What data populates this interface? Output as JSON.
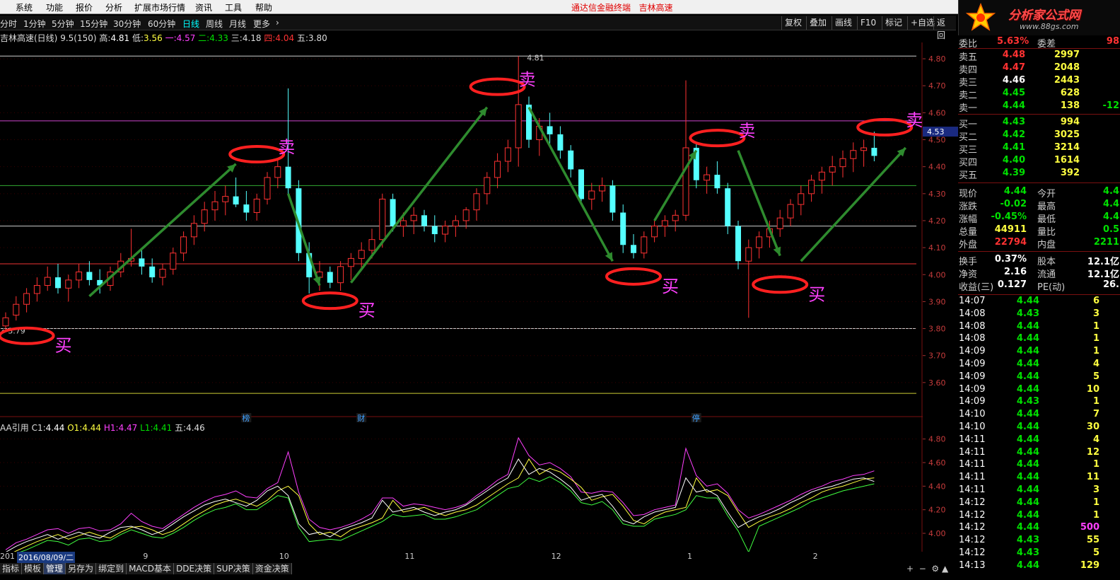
{
  "menu": {
    "items": [
      "系统",
      "功能",
      "报价",
      "分析",
      "扩展市场行情",
      "资讯",
      "工具",
      "帮助"
    ],
    "center_title": "通达信金融终端",
    "stock_name": "吉林高速"
  },
  "logo": {
    "text": "分析家公式网",
    "url": "www.88gs.com"
  },
  "periods": [
    "分时",
    "1分钟",
    "5分钟",
    "15分钟",
    "30分钟",
    "60分钟",
    "日线",
    "周线",
    "月线",
    "更多",
    "›"
  ],
  "active_period": "日线",
  "tools": [
    "复权",
    "叠加",
    "画线",
    "F10",
    "标记",
    "+自选",
    "返回"
  ],
  "info": {
    "name": "吉林高速(日线)",
    "pe": "9.5(150)",
    "high_label": "高:",
    "high": "4.81",
    "low_label": "低:",
    "low": "3.56",
    "l1_label": "一:",
    "l1": "4.57",
    "l2_label": "二:",
    "l2": "4.33",
    "l3_label": "三:",
    "l3": "4.18",
    "l4_label": "四:",
    "l4": "4.04",
    "l5_label": "五:",
    "l5": "3.80"
  },
  "indicator": {
    "name": "AA引用",
    "c1_label": "C1:",
    "c1": "4.44",
    "o1_label": "O1:",
    "o1": "4.44",
    "h1_label": "H1:",
    "h1": "4.47",
    "l1_label": "L1:",
    "l1": "4.41",
    "w_label": "五:",
    "w": "4.46"
  },
  "chart_data": {
    "type": "candlestick",
    "main_ylim": [
      3.5,
      4.85
    ],
    "main_ticks": [
      3.6,
      3.7,
      3.8,
      3.9,
      4.0,
      4.1,
      4.2,
      4.3,
      4.4,
      4.5,
      4.6,
      4.7,
      4.8
    ],
    "ind_ylim": [
      3.85,
      4.9
    ],
    "ind_ticks": [
      4.0,
      4.2,
      4.4,
      4.6,
      4.8
    ],
    "hlines": [
      4.81,
      4.57,
      4.33,
      4.18,
      4.04,
      3.8,
      3.56
    ],
    "hline_colors": [
      "#cccccc",
      "#cc44cc",
      "#33aa33",
      "#cccccc",
      "#ee3333",
      "#cccccc",
      "#cccc33"
    ],
    "current_price": "4.53",
    "max_label": "4.81",
    "min_label": "3.79",
    "candles": [
      [
        3.81,
        3.86,
        3.79,
        3.84
      ],
      [
        3.85,
        3.92,
        3.83,
        3.89
      ],
      [
        3.89,
        3.95,
        3.86,
        3.93
      ],
      [
        3.93,
        3.99,
        3.9,
        3.96
      ],
      [
        3.96,
        4.03,
        3.94,
        3.99
      ],
      [
        3.99,
        4.04,
        3.93,
        3.95
      ],
      [
        3.95,
        4.0,
        3.9,
        3.98
      ],
      [
        3.98,
        4.04,
        3.95,
        4.01
      ],
      [
        4.01,
        4.05,
        3.96,
        3.98
      ],
      [
        3.98,
        4.02,
        3.93,
        3.96
      ],
      [
        3.96,
        4.03,
        3.94,
        4.01
      ],
      [
        4.01,
        4.08,
        3.99,
        4.05
      ],
      [
        4.05,
        4.17,
        4.03,
        4.06
      ],
      [
        4.06,
        4.1,
        4.0,
        4.03
      ],
      [
        4.03,
        4.06,
        3.97,
        3.99
      ],
      [
        3.99,
        4.04,
        3.96,
        4.02
      ],
      [
        4.02,
        4.1,
        4.0,
        4.08
      ],
      [
        4.08,
        4.16,
        4.05,
        4.14
      ],
      [
        4.14,
        4.22,
        4.11,
        4.19
      ],
      [
        4.19,
        4.27,
        4.16,
        4.24
      ],
      [
        4.24,
        4.31,
        4.2,
        4.27
      ],
      [
        4.27,
        4.33,
        4.22,
        4.29
      ],
      [
        4.29,
        4.36,
        4.25,
        4.26
      ],
      [
        4.26,
        4.31,
        4.2,
        4.23
      ],
      [
        4.23,
        4.3,
        4.2,
        4.28
      ],
      [
        4.28,
        4.38,
        4.26,
        4.36
      ],
      [
        4.36,
        4.43,
        4.32,
        4.4
      ],
      [
        4.4,
        4.69,
        4.3,
        4.32
      ],
      [
        4.32,
        4.35,
        4.05,
        4.08
      ],
      [
        4.08,
        4.12,
        3.93,
        3.99
      ],
      [
        3.99,
        4.05,
        3.94,
        4.01
      ],
      [
        4.01,
        4.03,
        3.95,
        3.97
      ],
      [
        3.97,
        4.05,
        3.94,
        4.03
      ],
      [
        4.03,
        4.08,
        3.98,
        4.06
      ],
      [
        4.06,
        4.12,
        4.02,
        4.09
      ],
      [
        4.09,
        4.17,
        4.06,
        4.13
      ],
      [
        4.13,
        4.3,
        4.1,
        4.28
      ],
      [
        4.28,
        4.3,
        4.16,
        4.18
      ],
      [
        4.18,
        4.23,
        4.14,
        4.2
      ],
      [
        4.2,
        4.25,
        4.15,
        4.22
      ],
      [
        4.22,
        4.24,
        4.16,
        4.18
      ],
      [
        4.18,
        4.22,
        4.12,
        4.15
      ],
      [
        4.15,
        4.2,
        4.12,
        4.18
      ],
      [
        4.18,
        4.22,
        4.14,
        4.2
      ],
      [
        4.2,
        4.25,
        4.17,
        4.24
      ],
      [
        4.24,
        4.32,
        4.2,
        4.3
      ],
      [
        4.3,
        4.38,
        4.26,
        4.36
      ],
      [
        4.36,
        4.45,
        4.32,
        4.42
      ],
      [
        4.42,
        4.5,
        4.38,
        4.47
      ],
      [
        4.47,
        4.81,
        4.4,
        4.63
      ],
      [
        4.63,
        4.66,
        4.47,
        4.5
      ],
      [
        4.5,
        4.58,
        4.44,
        4.55
      ],
      [
        4.55,
        4.6,
        4.48,
        4.52
      ],
      [
        4.52,
        4.55,
        4.43,
        4.46
      ],
      [
        4.46,
        4.48,
        4.36,
        4.39
      ],
      [
        4.39,
        4.35,
        4.26,
        4.28
      ],
      [
        4.28,
        4.34,
        4.24,
        4.31
      ],
      [
        4.31,
        4.36,
        4.27,
        4.33
      ],
      [
        4.33,
        4.35,
        4.2,
        4.23
      ],
      [
        4.23,
        4.26,
        4.08,
        4.11
      ],
      [
        4.11,
        4.15,
        4.06,
        4.08
      ],
      [
        4.08,
        4.16,
        4.06,
        4.14
      ],
      [
        4.14,
        4.2,
        4.12,
        4.18
      ],
      [
        4.18,
        4.22,
        4.14,
        4.2
      ],
      [
        4.2,
        4.24,
        4.16,
        4.22
      ],
      [
        4.22,
        4.72,
        4.2,
        4.47
      ],
      [
        4.47,
        4.49,
        4.32,
        4.35
      ],
      [
        4.35,
        4.4,
        4.3,
        4.37
      ],
      [
        4.37,
        4.42,
        4.3,
        4.32
      ],
      [
        4.32,
        4.34,
        4.15,
        4.18
      ],
      [
        4.18,
        4.2,
        4.02,
        4.05
      ],
      [
        4.05,
        4.13,
        3.84,
        4.1
      ],
      [
        4.1,
        4.16,
        4.06,
        4.14
      ],
      [
        4.14,
        4.2,
        4.1,
        4.17
      ],
      [
        4.17,
        4.24,
        4.14,
        4.21
      ],
      [
        4.21,
        4.28,
        4.18,
        4.26
      ],
      [
        4.26,
        4.33,
        4.22,
        4.3
      ],
      [
        4.3,
        4.37,
        4.27,
        4.35
      ],
      [
        4.35,
        4.4,
        4.3,
        4.38
      ],
      [
        4.38,
        4.44,
        4.33,
        4.4
      ],
      [
        4.4,
        4.46,
        4.36,
        4.43
      ],
      [
        4.43,
        4.49,
        4.38,
        4.46
      ],
      [
        4.46,
        4.5,
        4.4,
        4.47
      ],
      [
        4.47,
        4.53,
        4.42,
        4.44
      ]
    ],
    "annotations": [
      {
        "label": "买",
        "i": 2,
        "p": 3.81,
        "side": "buy"
      },
      {
        "label": "卖",
        "i": 24,
        "p": 4.42,
        "side": "sell"
      },
      {
        "label": "买",
        "i": 31,
        "p": 3.94,
        "side": "buy"
      },
      {
        "label": "卖",
        "i": 47,
        "p": 4.67,
        "side": "sell"
      },
      {
        "label": "买",
        "i": 60,
        "p": 4.03,
        "side": "buy"
      },
      {
        "label": "卖",
        "i": 68,
        "p": 4.48,
        "side": "sell"
      },
      {
        "label": "买",
        "i": 74,
        "p": 4.0,
        "side": "buy"
      },
      {
        "label": "卖",
        "i": 84,
        "p": 4.52,
        "side": "sell"
      }
    ],
    "arrows": [
      [
        8,
        3.92,
        22,
        4.41
      ],
      [
        27,
        4.3,
        30,
        3.96
      ],
      [
        33,
        3.97,
        46,
        4.62
      ],
      [
        50,
        4.62,
        58,
        4.05
      ],
      [
        62,
        4.2,
        66,
        4.46
      ],
      [
        70,
        4.46,
        74,
        4.07
      ],
      [
        76,
        4.05,
        86,
        4.47
      ]
    ],
    "markers": [
      {
        "label": "榜",
        "i": 23
      },
      {
        "label": "财",
        "i": 34
      },
      {
        "label": "停",
        "i": 66
      }
    ],
    "date_labels": [
      {
        "label": "2016/08/09/二",
        "i": 2
      },
      {
        "label": "9",
        "i": 13
      },
      {
        "label": "10",
        "i": 26
      },
      {
        "label": "11",
        "i": 38
      },
      {
        "label": "12",
        "i": 52
      },
      {
        "label": "1",
        "i": 65
      },
      {
        "label": "2",
        "i": 77
      }
    ],
    "date_prefix": "201"
  },
  "bottom_tabs": [
    "指标",
    "模板",
    "管理",
    "另存为",
    "绑定到",
    "MACD基本",
    "DDE决策",
    "SUP决策",
    "资金决策"
  ],
  "active_tab": "管理",
  "panel": {
    "wei": {
      "label1": "委比",
      "val1": "5.63%",
      "label2": "委差",
      "val2": "98"
    },
    "asks": [
      {
        "label": "卖五",
        "price": "4.48",
        "vol": "2997",
        "chg": ""
      },
      {
        "label": "卖四",
        "price": "4.47",
        "vol": "2048",
        "chg": ""
      },
      {
        "label": "卖三",
        "price": "4.46",
        "vol": "2443",
        "chg": ""
      },
      {
        "label": "卖二",
        "price": "4.45",
        "vol": "628",
        "chg": ""
      },
      {
        "label": "卖一",
        "price": "4.44",
        "vol": "138",
        "chg": "-12"
      }
    ],
    "bids": [
      {
        "label": "买一",
        "price": "4.43",
        "vol": "994"
      },
      {
        "label": "买二",
        "price": "4.42",
        "vol": "3025"
      },
      {
        "label": "买三",
        "price": "4.41",
        "vol": "3214"
      },
      {
        "label": "买四",
        "price": "4.40",
        "vol": "1614"
      },
      {
        "label": "买五",
        "price": "4.39",
        "vol": "392"
      }
    ],
    "stats": [
      {
        "l1": "现价",
        "v1": "4.44",
        "l2": "今开",
        "v2": "4.4"
      },
      {
        "l1": "涨跌",
        "v1": "-0.02",
        "l2": "最高",
        "v2": "4.4"
      },
      {
        "l1": "涨幅",
        "v1": "-0.45%",
        "l2": "最低",
        "v2": "4.4"
      },
      {
        "l1": "总量",
        "v1": "44911",
        "l2": "量比",
        "v2": "0.5"
      },
      {
        "l1": "外盘",
        "v1": "22794",
        "l2": "内盘",
        "v2": "2211"
      }
    ],
    "stats2": [
      {
        "l1": "换手",
        "v1": "0.37%",
        "l2": "股本",
        "v2": "12.1亿"
      },
      {
        "l1": "净资",
        "v1": "2.16",
        "l2": "流通",
        "v2": "12.1亿"
      },
      {
        "l1": "收益(三)",
        "v1": "0.127",
        "l2": "PE(动)",
        "v2": "26."
      }
    ],
    "ticks": [
      {
        "t": "14:07",
        "p": "4.44",
        "v": "6"
      },
      {
        "t": "14:08",
        "p": "4.43",
        "v": "3"
      },
      {
        "t": "14:08",
        "p": "4.44",
        "v": "1"
      },
      {
        "t": "14:08",
        "p": "4.44",
        "v": "1"
      },
      {
        "t": "14:09",
        "p": "4.44",
        "v": "1"
      },
      {
        "t": "14:09",
        "p": "4.44",
        "v": "4"
      },
      {
        "t": "14:09",
        "p": "4.44",
        "v": "5"
      },
      {
        "t": "14:09",
        "p": "4.44",
        "v": "10"
      },
      {
        "t": "14:09",
        "p": "4.43",
        "v": "1"
      },
      {
        "t": "14:10",
        "p": "4.44",
        "v": "7"
      },
      {
        "t": "14:10",
        "p": "4.44",
        "v": "30"
      },
      {
        "t": "14:11",
        "p": "4.44",
        "v": "4"
      },
      {
        "t": "14:11",
        "p": "4.44",
        "v": "12"
      },
      {
        "t": "14:11",
        "p": "4.44",
        "v": "1"
      },
      {
        "t": "14:11",
        "p": "4.44",
        "v": "11"
      },
      {
        "t": "14:11",
        "p": "4.44",
        "v": "3"
      },
      {
        "t": "14:12",
        "p": "4.44",
        "v": "1"
      },
      {
        "t": "14:12",
        "p": "4.44",
        "v": "1"
      },
      {
        "t": "14:12",
        "p": "4.44",
        "v": "500"
      },
      {
        "t": "14:12",
        "p": "4.43",
        "v": "55"
      },
      {
        "t": "14:12",
        "p": "4.43",
        "v": "5"
      },
      {
        "t": "14:13",
        "p": "4.44",
        "v": "129"
      }
    ]
  },
  "colors": {
    "up": "#ff3232",
    "down": "#54ffff",
    "ma_white": "#ffffff",
    "ma_yellow": "#ffff40",
    "ma_mag": "#ff40ff",
    "ma_green": "#40ff40",
    "arrow": "#2e8b2e",
    "circle": "#ff2020",
    "annot": "#ff40ff"
  }
}
